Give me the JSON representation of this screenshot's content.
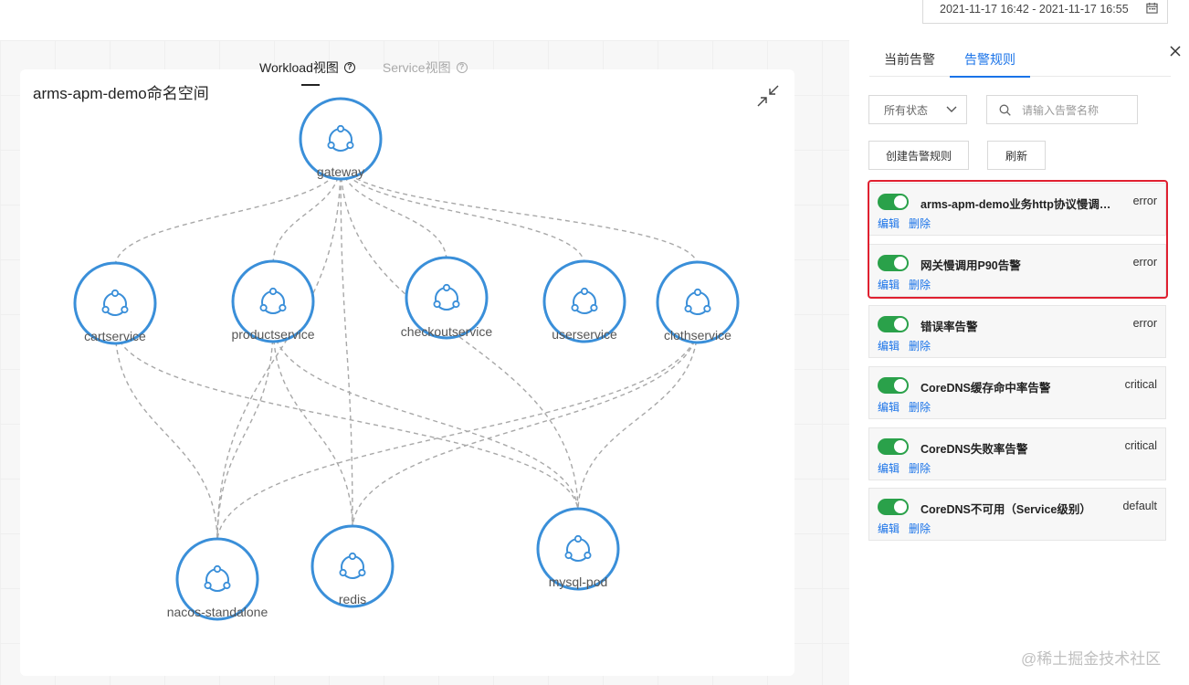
{
  "date_range": "2021-11-17 16:42 - 2021-11-17 16:55",
  "view_tabs": [
    {
      "label": "Workload视图",
      "active": true
    },
    {
      "label": "Service视图",
      "active": false
    }
  ],
  "graph": {
    "title": "arms-apm-demo命名空间",
    "nodes": [
      {
        "id": "gateway",
        "label": "gateway"
      },
      {
        "id": "cartservice",
        "label": "cartservice"
      },
      {
        "id": "productservice",
        "label": "productservice"
      },
      {
        "id": "checkoutservice",
        "label": "checkoutservice"
      },
      {
        "id": "userservice",
        "label": "userservice"
      },
      {
        "id": "clothservice",
        "label": "clothservice"
      },
      {
        "id": "nacos",
        "label": "nacos-standalone"
      },
      {
        "id": "redis",
        "label": "redis"
      },
      {
        "id": "mysql",
        "label": "mysql-pod"
      }
    ],
    "edges": [
      [
        "gateway",
        "cartservice"
      ],
      [
        "gateway",
        "productservice"
      ],
      [
        "gateway",
        "checkoutservice"
      ],
      [
        "gateway",
        "userservice"
      ],
      [
        "gateway",
        "clothservice"
      ],
      [
        "gateway",
        "nacos"
      ],
      [
        "gateway",
        "redis"
      ],
      [
        "gateway",
        "mysql"
      ],
      [
        "cartservice",
        "nacos"
      ],
      [
        "cartservice",
        "mysql"
      ],
      [
        "productservice",
        "nacos"
      ],
      [
        "productservice",
        "redis"
      ],
      [
        "productservice",
        "mysql"
      ],
      [
        "clothservice",
        "nacos"
      ],
      [
        "clothservice",
        "redis"
      ],
      [
        "clothservice",
        "mysql"
      ]
    ],
    "node_color": "#3a8fd9",
    "edge_color": "#a8a8a8"
  },
  "panel": {
    "tabs": [
      {
        "label": "当前告警",
        "active": false
      },
      {
        "label": "告警规则",
        "active": true
      }
    ],
    "status_select": "所有状态",
    "search_placeholder": "请输入告警名称",
    "create_button": "创建告警规则",
    "refresh_button": "刷新",
    "edit_label": "编辑",
    "delete_label": "删除",
    "rules": [
      {
        "name": "arms-apm-demo业务http协议慢调用告警",
        "level": "error",
        "enabled": true
      },
      {
        "name": "网关慢调用P90告警",
        "level": "error",
        "enabled": true
      },
      {
        "name": "错误率告警",
        "level": "error",
        "enabled": true
      },
      {
        "name": "CoreDNS缓存命中率告警",
        "level": "critical",
        "enabled": true
      },
      {
        "name": "CoreDNS失败率告警",
        "level": "critical",
        "enabled": true
      },
      {
        "name": "CoreDNS不可用（Service级别）",
        "level": "default",
        "enabled": true
      }
    ],
    "accent_color": "#1a73e8",
    "toggle_color": "#2aa14a",
    "highlight_color": "#e02030"
  },
  "watermark": "@稀土掘金技术社区"
}
